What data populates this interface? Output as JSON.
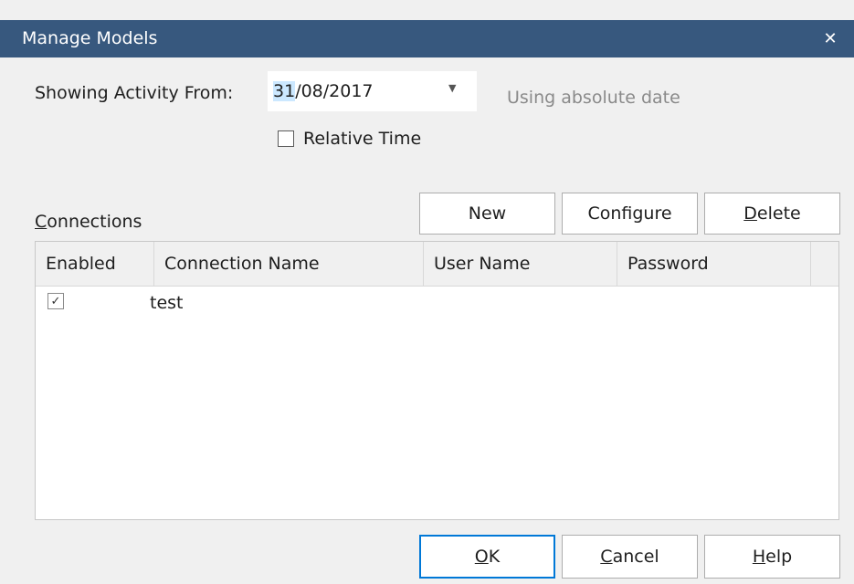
{
  "window": {
    "title": "Manage Models",
    "close_glyph": "✕",
    "titlebar_color": "#37587e"
  },
  "activity": {
    "label": "Showing Activity From:",
    "date_day": "31",
    "date_rest": "/08/2017",
    "dropdown_glyph": "▼",
    "hint": "Using absolute date"
  },
  "relative_time": {
    "label": "Relative Time",
    "checked": false
  },
  "connections": {
    "label_first": "C",
    "label_rest": "onnections",
    "buttons": {
      "new": "New",
      "configure": "Configure",
      "delete_first": "D",
      "delete_rest": "elete"
    },
    "columns": [
      "Enabled",
      "Connection Name",
      "User Name",
      "Password"
    ],
    "rows": [
      {
        "enabled": true,
        "enabled_glyph": "✓",
        "connection_name": "test",
        "user_name": "",
        "password": ""
      }
    ]
  },
  "footer": {
    "ok_first": "O",
    "ok_rest": "K",
    "cancel_first": "C",
    "cancel_rest": "ancel",
    "help_first": "H",
    "help_rest": "elp",
    "default_button_color": "#0078d7"
  }
}
